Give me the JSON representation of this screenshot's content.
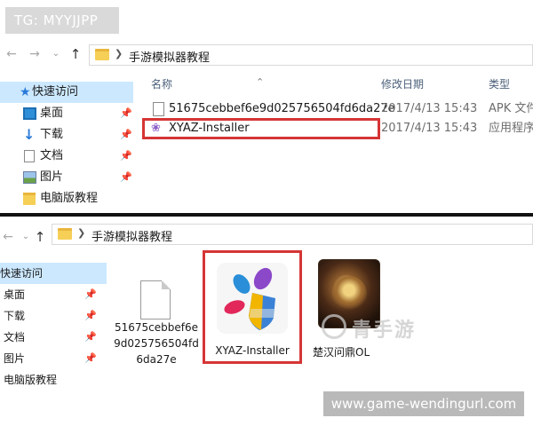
{
  "watermark": {
    "tg": "TG: MYYJJPP",
    "logo_text": "青手游",
    "url": "www.game-wendingurl.com"
  },
  "top_explorer": {
    "path": "手游模拟器教程",
    "sidebar": [
      {
        "label": "快速访问",
        "icon": "star-icon",
        "selected": true
      },
      {
        "label": "桌面",
        "icon": "desktop-icon",
        "pinned": true
      },
      {
        "label": "下载",
        "icon": "download-icon",
        "pinned": true
      },
      {
        "label": "文档",
        "icon": "document-icon",
        "pinned": true
      },
      {
        "label": "图片",
        "icon": "pictures-icon",
        "pinned": true
      },
      {
        "label": "电脑版教程",
        "icon": "folder-icon"
      }
    ],
    "columns": {
      "name": "名称",
      "date": "修改日期",
      "type": "类型"
    },
    "files": [
      {
        "name": "51675cebbef6e9d025756504fd6da27e",
        "date": "2017/4/13 15:43",
        "type": "APK 文件",
        "icon": "file-icon"
      },
      {
        "name": "XYAZ-Installer",
        "date": "2017/4/13 15:43",
        "type": "应用程序",
        "icon": "pinwheel-icon",
        "highlighted": true
      }
    ]
  },
  "bottom_explorer": {
    "path": "手游模拟器教程",
    "sidebar": [
      {
        "label": "快速访问",
        "selected": true
      },
      {
        "label": "桌面",
        "pinned": true
      },
      {
        "label": "下载",
        "pinned": true
      },
      {
        "label": "文档",
        "pinned": true
      },
      {
        "label": "图片",
        "pinned": true
      },
      {
        "label": "电脑版教程"
      }
    ],
    "tiles": [
      {
        "name": "51675cebbef6e9d025756504fd6da27e",
        "icon": "file-icon"
      },
      {
        "name": "XYAZ-Installer",
        "icon": "xyaz-app-icon",
        "highlighted": true
      },
      {
        "name": "楚汉问鼎OL",
        "icon": "game-icon"
      }
    ]
  },
  "colors": {
    "highlight": "#d53536",
    "selection": "#cce8ff",
    "folder": "#f6cf57"
  }
}
